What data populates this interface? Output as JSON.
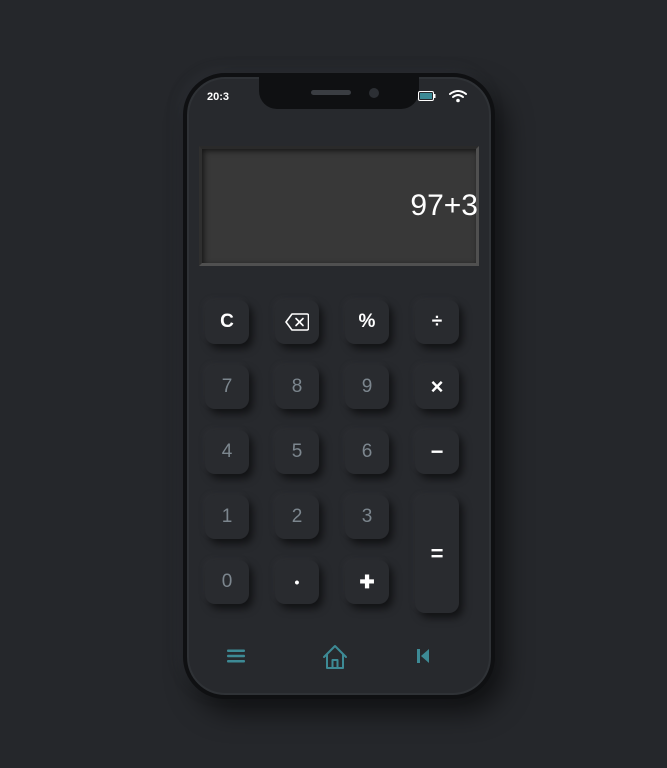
{
  "status_bar": {
    "time": "20:3"
  },
  "display": {
    "value": "97+3"
  },
  "keys": {
    "clear": "C",
    "backspace_icon": "backspace-icon",
    "percent": "%",
    "divide": "÷",
    "seven": "7",
    "eight": "8",
    "nine": "9",
    "multiply": "×",
    "four": "4",
    "five": "5",
    "six": "6",
    "minus": "−",
    "one": "1",
    "two": "2",
    "three": "3",
    "equals": "=",
    "zero": "0",
    "dot": "•",
    "plus": "✚"
  },
  "bottom_nav": {
    "menu_icon": "menu-icon",
    "home_icon": "home-icon",
    "back_icon": "skip-back-icon"
  },
  "colors": {
    "background": "#25272b",
    "phone_body": "#27292d",
    "screen_bg": "#383838",
    "accent": "#3d8a95",
    "digit_text": "#7c868e",
    "operator_text": "#ffffff"
  }
}
